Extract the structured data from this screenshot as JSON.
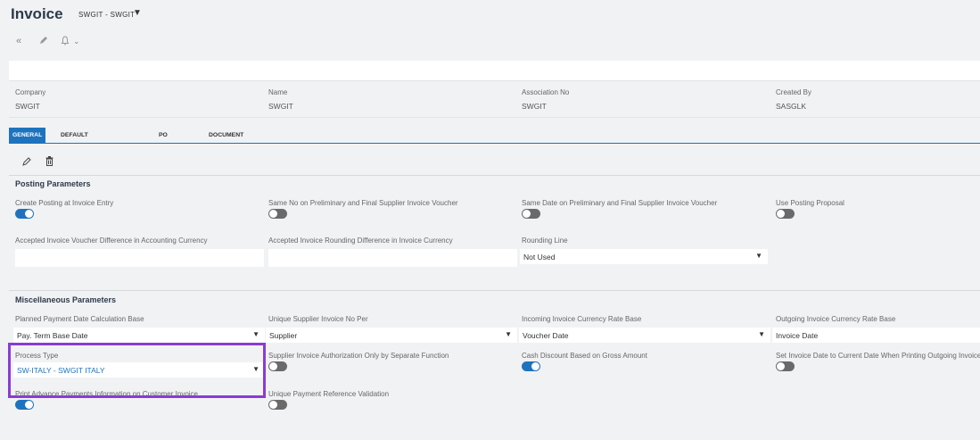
{
  "header": {
    "title": "Invoice",
    "subtitle": "SWGIT - SWGIT"
  },
  "toolbar_icons": [
    "double-chevron-left-icon",
    "pencil-icon",
    "bell-icon",
    "chevron-down-icon"
  ],
  "info": {
    "company_label": "Company",
    "company_value": "SWGIT",
    "name_label": "Name",
    "name_value": "SWGIT",
    "association_label": "Association No",
    "association_value": "SWGIT",
    "created_by_label": "Created By",
    "created_by_value": "SASGLK"
  },
  "tabs": [
    {
      "label": "GENERAL"
    },
    {
      "label": "DEFAULT INVOICE TYPES"
    },
    {
      "label": "PO MATCHING"
    },
    {
      "label": "DOCUMENT MANAGEMENT"
    }
  ],
  "posting": {
    "title": "Posting Parameters",
    "create_posting_label": "Create Posting at Invoice Entry",
    "create_posting_on": true,
    "same_no_label": "Same No on Preliminary and Final Supplier Invoice Voucher",
    "same_no_on": false,
    "same_date_label": "Same Date on Preliminary and Final Supplier Invoice Voucher",
    "same_date_on": false,
    "use_posting_label": "Use Posting Proposal",
    "use_posting_on": false,
    "accepted_voucher_label": "Accepted Invoice Voucher Difference in Accounting Currency",
    "accepted_voucher_value": "",
    "accepted_rounding_label": "Accepted Invoice Rounding Difference in Invoice Currency",
    "accepted_rounding_value": "",
    "rounding_line_label": "Rounding Line",
    "rounding_line_value": "Not Used"
  },
  "misc": {
    "title": "Miscellaneous Parameters",
    "planned_payment_label": "Planned Payment Date Calculation Base",
    "planned_payment_value": "Pay. Term Base Date",
    "unique_supplier_label": "Unique Supplier Invoice No Per",
    "unique_supplier_value": "Supplier",
    "incoming_rate_label": "Incoming Invoice Currency Rate Base",
    "incoming_rate_value": "Voucher Date",
    "outgoing_rate_label": "Outgoing Invoice Currency Rate Base",
    "outgoing_rate_value": "Invoice Date",
    "process_type_label": "Process Type",
    "process_type_value": "SW-ITALY - SWGIT ITALY",
    "supplier_auth_label": "Supplier Invoice Authorization Only by Separate Function",
    "supplier_auth_on": false,
    "cash_discount_label": "Cash Discount Based on Gross Amount",
    "cash_discount_on": true,
    "set_invoice_date_label": "Set Invoice Date to Current Date When Printing Outgoing Invoices",
    "set_invoice_date_on": false,
    "print_advance_label": "Print Advance Payments Information on Customer Invoice",
    "print_advance_on": true,
    "unique_payment_ref_label": "Unique Payment Reference Validation",
    "unique_payment_ref_on": false
  },
  "colors": {
    "accent": "#1e73be",
    "highlight": "#8a3bd6",
    "link": "#1e73be"
  }
}
